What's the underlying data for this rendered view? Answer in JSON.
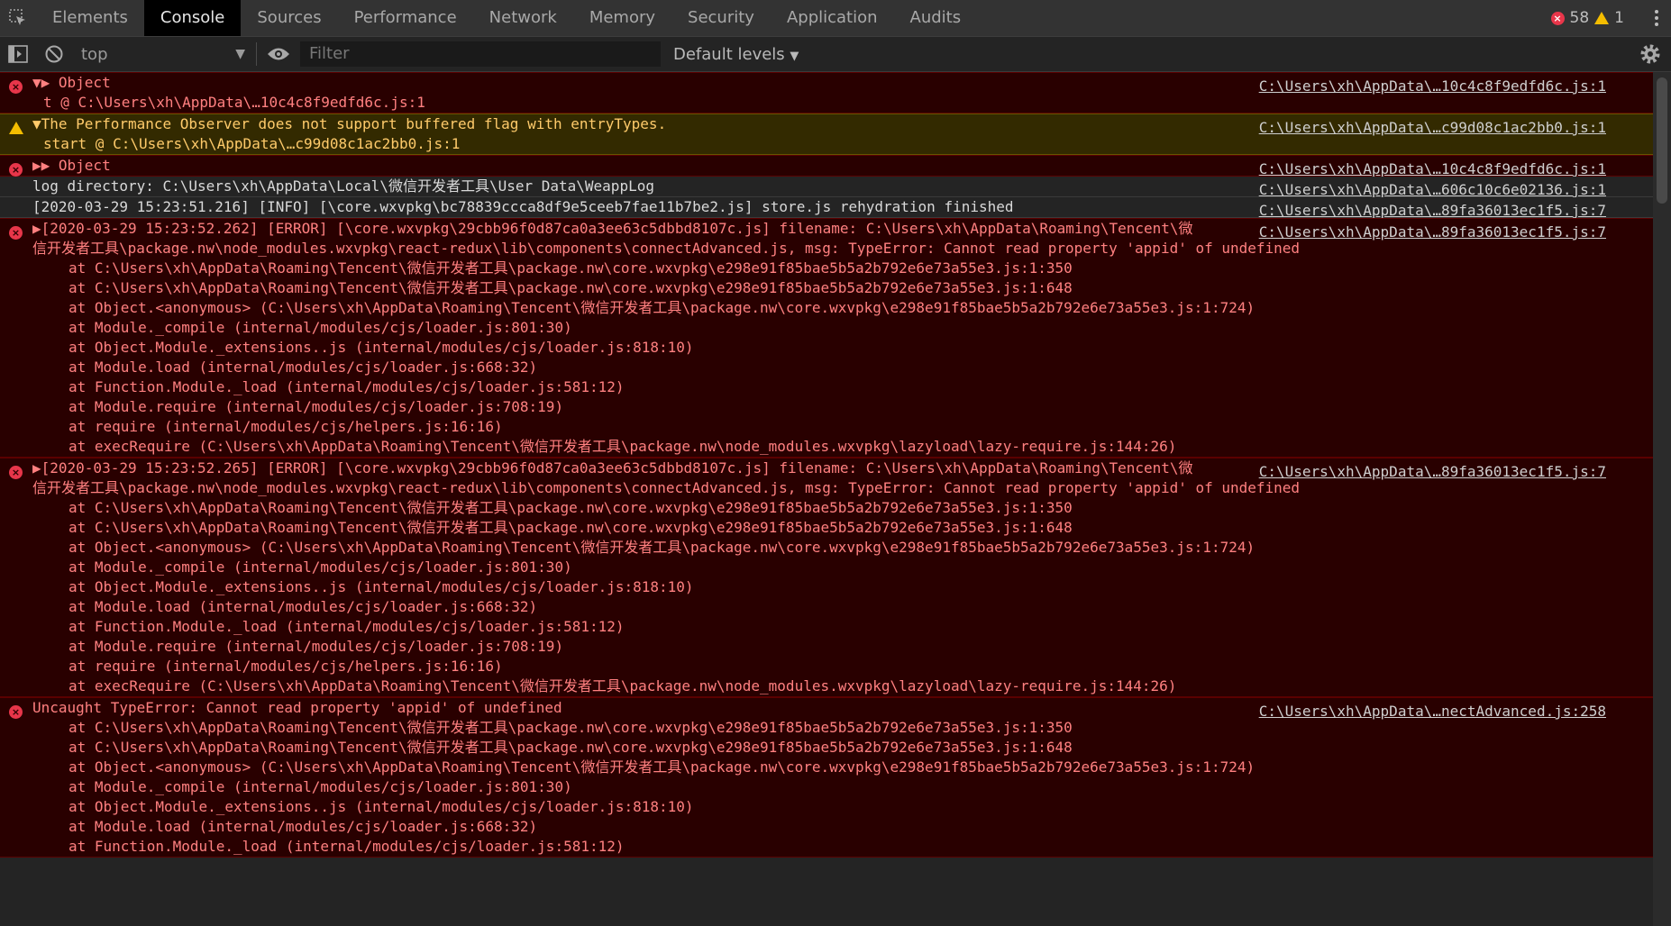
{
  "tabs": [
    "Elements",
    "Console",
    "Sources",
    "Performance",
    "Network",
    "Memory",
    "Security",
    "Application",
    "Audits"
  ],
  "active_tab": "Console",
  "counts": {
    "errors": "58",
    "warnings": "1"
  },
  "toolbar": {
    "context": "top",
    "filter_placeholder": "Filter",
    "levels": "Default levels"
  },
  "messages": [
    {
      "level": "error",
      "lines": [
        "▼▶ Object"
      ],
      "stack": [
        "t @ C:\\Users\\xh\\AppData\\…10c4c8f9edfd6c.js:1"
      ],
      "source": "C:\\Users\\xh\\AppData\\…10c4c8f9edfd6c.js:1"
    },
    {
      "level": "warn",
      "lines": [
        "▼The Performance Observer does not support buffered flag with entryTypes."
      ],
      "stack": [
        "start @ C:\\Users\\xh\\AppData\\…c99d08c1ac2bb0.js:1"
      ],
      "source": "C:\\Users\\xh\\AppData\\…c99d08c1ac2bb0.js:1"
    },
    {
      "level": "error",
      "lines": [
        "▶▶ Object"
      ],
      "stack": [],
      "source": "C:\\Users\\xh\\AppData\\…10c4c8f9edfd6c.js:1"
    },
    {
      "level": "log",
      "lines": [
        "log directory: C:\\Users\\xh\\AppData\\Local\\微信开发者工具\\User Data\\WeappLog"
      ],
      "stack": [],
      "source": "C:\\Users\\xh\\AppData\\…606c10c6e02136.js:1"
    },
    {
      "level": "log",
      "lines": [
        "[2020-03-29 15:23:51.216] [INFO] [\\core.wxvpkg\\bc78839ccca8df9e5ceeb7fae11b7be2.js] store.js rehydration finished"
      ],
      "stack": [],
      "source": "C:\\Users\\xh\\AppData\\…89fa36013ec1f5.js:7"
    },
    {
      "level": "error",
      "lines": [
        "▶[2020-03-29 15:23:52.262] [ERROR] [\\core.wxvpkg\\29cbb96f0d87ca0a3ee63c5dbbd8107c.js] filename: C:\\Users\\xh\\AppData\\Roaming\\Tencent\\微",
        "信开发者工具\\package.nw\\node_modules.wxvpkg\\react-redux\\lib\\components\\connectAdvanced.js, msg: TypeError: Cannot read property 'appid' of undefined"
      ],
      "stack": [
        "at C:\\Users\\xh\\AppData\\Roaming\\Tencent\\微信开发者工具\\package.nw\\core.wxvpkg\\e298e91f85bae5b5a2b792e6e73a55e3.js:1:350",
        "at C:\\Users\\xh\\AppData\\Roaming\\Tencent\\微信开发者工具\\package.nw\\core.wxvpkg\\e298e91f85bae5b5a2b792e6e73a55e3.js:1:648",
        "at Object.<anonymous> (C:\\Users\\xh\\AppData\\Roaming\\Tencent\\微信开发者工具\\package.nw\\core.wxvpkg\\e298e91f85bae5b5a2b792e6e73a55e3.js:1:724)",
        "at Module._compile (internal/modules/cjs/loader.js:801:30)",
        "at Object.Module._extensions..js (internal/modules/cjs/loader.js:818:10)",
        "at Module.load (internal/modules/cjs/loader.js:668:32)",
        "at Function.Module._load (internal/modules/cjs/loader.js:581:12)",
        "at Module.require (internal/modules/cjs/loader.js:708:19)",
        "at require (internal/modules/cjs/helpers.js:16:16)",
        "at execRequire (C:\\Users\\xh\\AppData\\Roaming\\Tencent\\微信开发者工具\\package.nw\\node_modules.wxvpkg\\lazyload\\lazy-require.js:144:26)"
      ],
      "source": "C:\\Users\\xh\\AppData\\…89fa36013ec1f5.js:7"
    },
    {
      "level": "error",
      "lines": [
        "▶[2020-03-29 15:23:52.265] [ERROR] [\\core.wxvpkg\\29cbb96f0d87ca0a3ee63c5dbbd8107c.js] filename: C:\\Users\\xh\\AppData\\Roaming\\Tencent\\微",
        "信开发者工具\\package.nw\\node_modules.wxvpkg\\react-redux\\lib\\components\\connectAdvanced.js, msg: TypeError: Cannot read property 'appid' of undefined"
      ],
      "stack": [
        "at C:\\Users\\xh\\AppData\\Roaming\\Tencent\\微信开发者工具\\package.nw\\core.wxvpkg\\e298e91f85bae5b5a2b792e6e73a55e3.js:1:350",
        "at C:\\Users\\xh\\AppData\\Roaming\\Tencent\\微信开发者工具\\package.nw\\core.wxvpkg\\e298e91f85bae5b5a2b792e6e73a55e3.js:1:648",
        "at Object.<anonymous> (C:\\Users\\xh\\AppData\\Roaming\\Tencent\\微信开发者工具\\package.nw\\core.wxvpkg\\e298e91f85bae5b5a2b792e6e73a55e3.js:1:724)",
        "at Module._compile (internal/modules/cjs/loader.js:801:30)",
        "at Object.Module._extensions..js (internal/modules/cjs/loader.js:818:10)",
        "at Module.load (internal/modules/cjs/loader.js:668:32)",
        "at Function.Module._load (internal/modules/cjs/loader.js:581:12)",
        "at Module.require (internal/modules/cjs/loader.js:708:19)",
        "at require (internal/modules/cjs/helpers.js:16:16)",
        "at execRequire (C:\\Users\\xh\\AppData\\Roaming\\Tencent\\微信开发者工具\\package.nw\\node_modules.wxvpkg\\lazyload\\lazy-require.js:144:26)"
      ],
      "source": "C:\\Users\\xh\\AppData\\…89fa36013ec1f5.js:7"
    },
    {
      "level": "error",
      "lines": [
        "Uncaught TypeError: Cannot read property 'appid' of undefined"
      ],
      "stack": [
        "at C:\\Users\\xh\\AppData\\Roaming\\Tencent\\微信开发者工具\\package.nw\\core.wxvpkg\\e298e91f85bae5b5a2b792e6e73a55e3.js:1:350",
        "at C:\\Users\\xh\\AppData\\Roaming\\Tencent\\微信开发者工具\\package.nw\\core.wxvpkg\\e298e91f85bae5b5a2b792e6e73a55e3.js:1:648",
        "at Object.<anonymous> (C:\\Users\\xh\\AppData\\Roaming\\Tencent\\微信开发者工具\\package.nw\\core.wxvpkg\\e298e91f85bae5b5a2b792e6e73a55e3.js:1:724)",
        "at Module._compile (internal/modules/cjs/loader.js:801:30)",
        "at Object.Module._extensions..js (internal/modules/cjs/loader.js:818:10)",
        "at Module.load (internal/modules/cjs/loader.js:668:32)",
        "at Function.Module._load (internal/modules/cjs/loader.js:581:12)"
      ],
      "source": "C:\\Users\\xh\\AppData\\…nectAdvanced.js:258"
    }
  ]
}
